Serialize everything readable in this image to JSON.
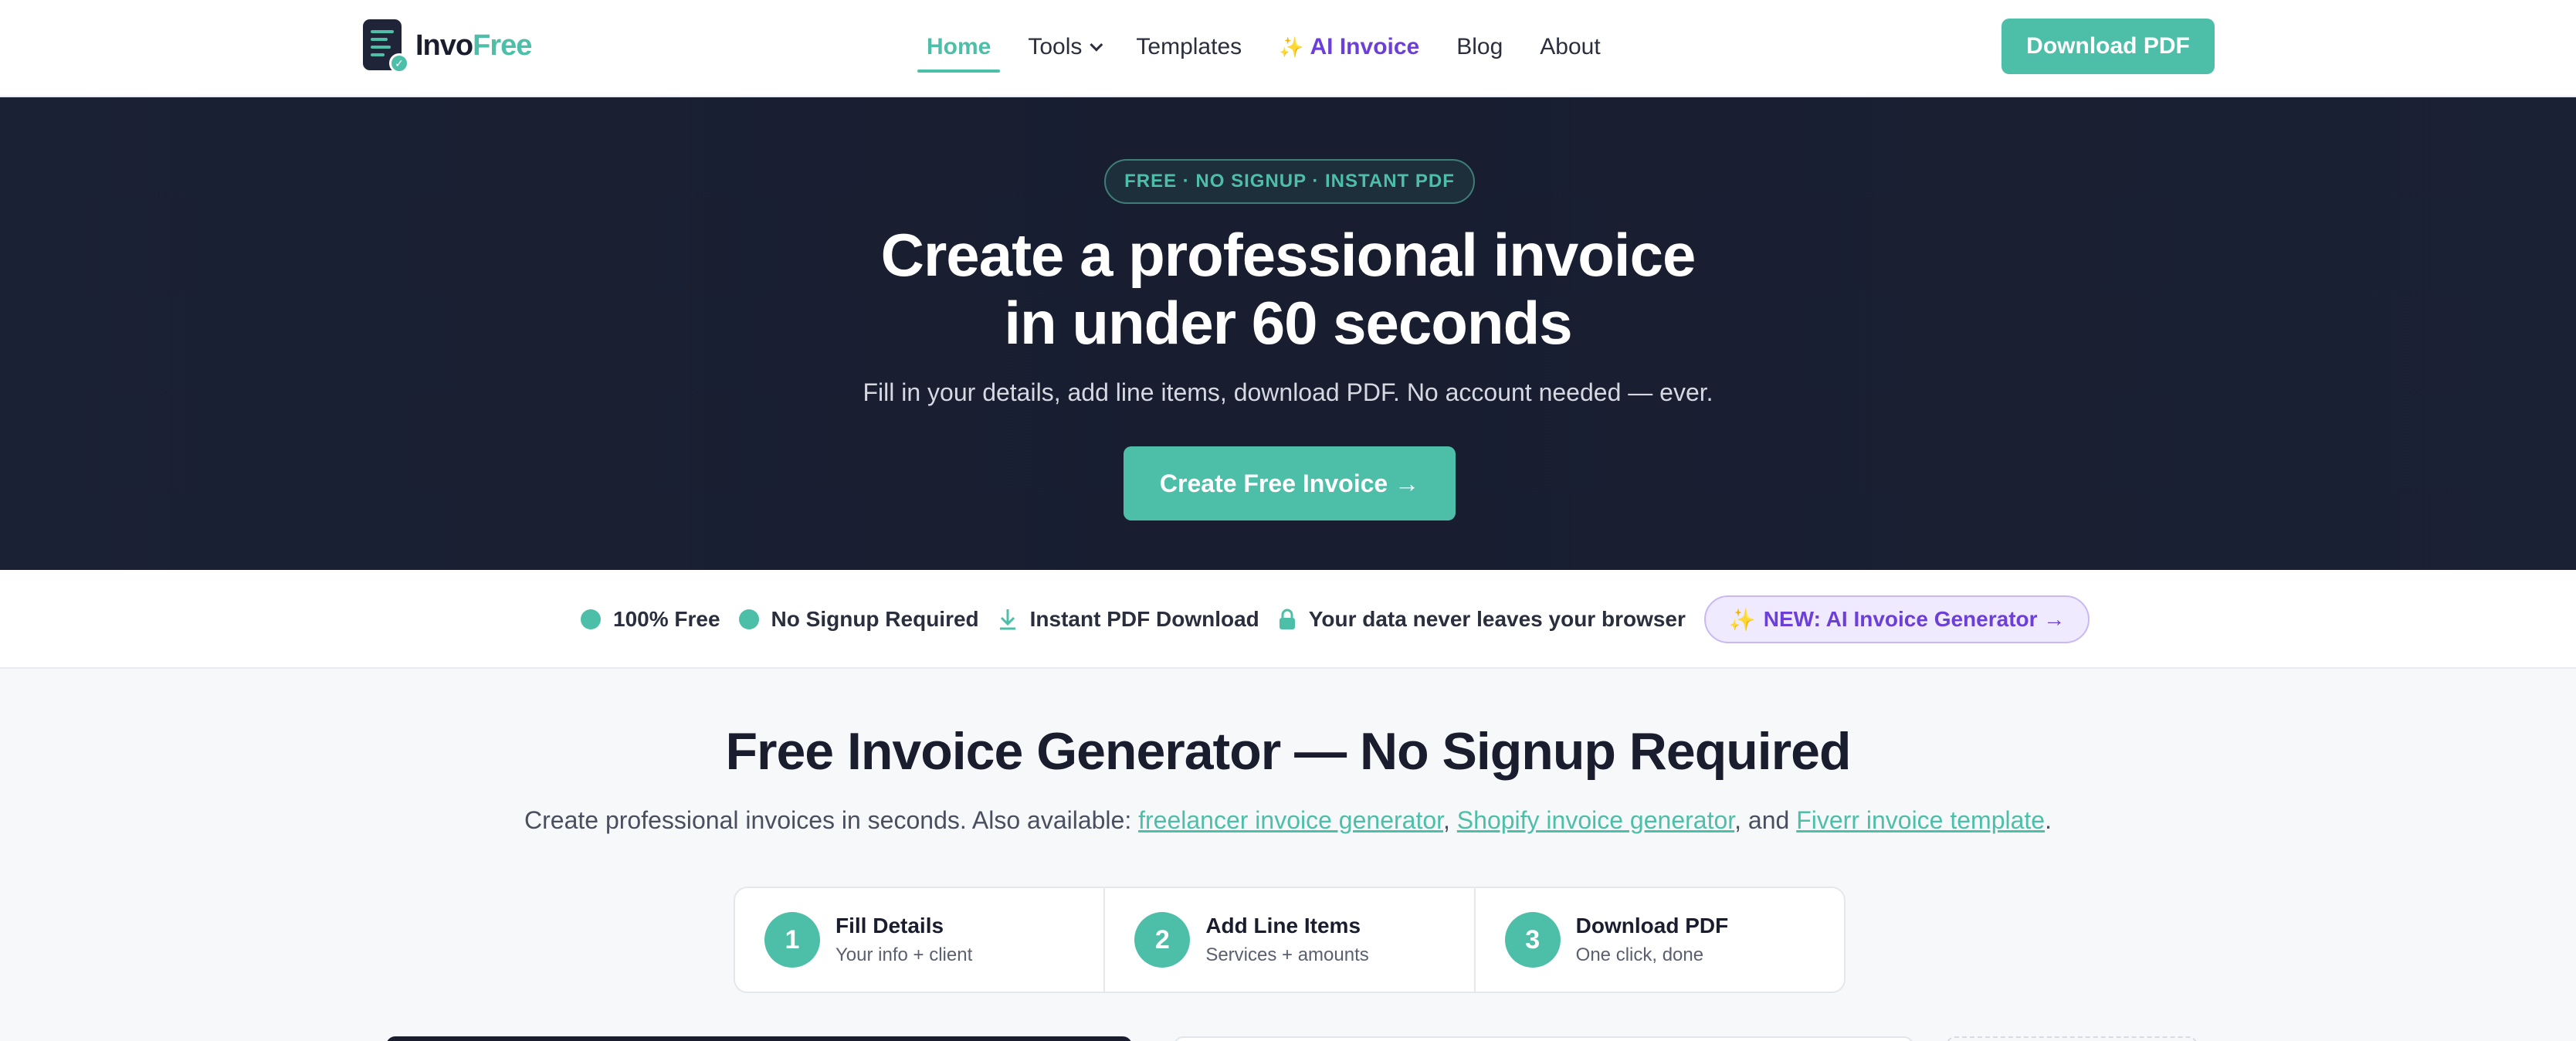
{
  "brand": {
    "name_part1": "Invo",
    "name_part2": "Free"
  },
  "nav": {
    "links": [
      {
        "label": "Home"
      },
      {
        "label": "Tools"
      },
      {
        "label": "Templates"
      },
      {
        "label": "AI Invoice"
      },
      {
        "label": "Blog"
      },
      {
        "label": "About"
      }
    ],
    "download_label": "Download PDF"
  },
  "hero": {
    "badge": "FREE · NO SIGNUP · INSTANT PDF",
    "title_line1": "Create a professional invoice",
    "title_line2": "in under 60 seconds",
    "subtitle": "Fill in your details, add line items, download PDF. No account needed — ever.",
    "cta": "Create Free Invoice →"
  },
  "trust": {
    "items": [
      {
        "label": "100% Free"
      },
      {
        "label": "No Signup Required"
      },
      {
        "label": "Instant PDF Download"
      },
      {
        "label": "Your data never leaves your browser"
      }
    ],
    "ai_pill": "NEW: AI Invoice Generator →"
  },
  "main": {
    "title": "Free Invoice Generator — No Signup Required",
    "sub_prefix": "Create professional invoices in seconds. Also available: ",
    "link1": "freelancer invoice generator",
    "sep1": ", ",
    "link2": "Shopify invoice generator",
    "sep2": ", and ",
    "link3": "Fiverr invoice template",
    "sub_suffix": "."
  },
  "steps": [
    {
      "num": "1",
      "title": "Fill Details",
      "desc": "Your info + client"
    },
    {
      "num": "2",
      "title": "Add Line Items",
      "desc": "Services + amounts"
    },
    {
      "num": "3",
      "title": "Download PDF",
      "desc": "One click, done"
    }
  ],
  "colors": {
    "accent": "#4dbfa8",
    "hero_bg": "#1b2134",
    "ai_purple": "#6b3fd8"
  },
  "icons": [
    "logo-icon",
    "chevron-down-icon",
    "sparkle-icon",
    "download-icon",
    "lock-icon"
  ]
}
